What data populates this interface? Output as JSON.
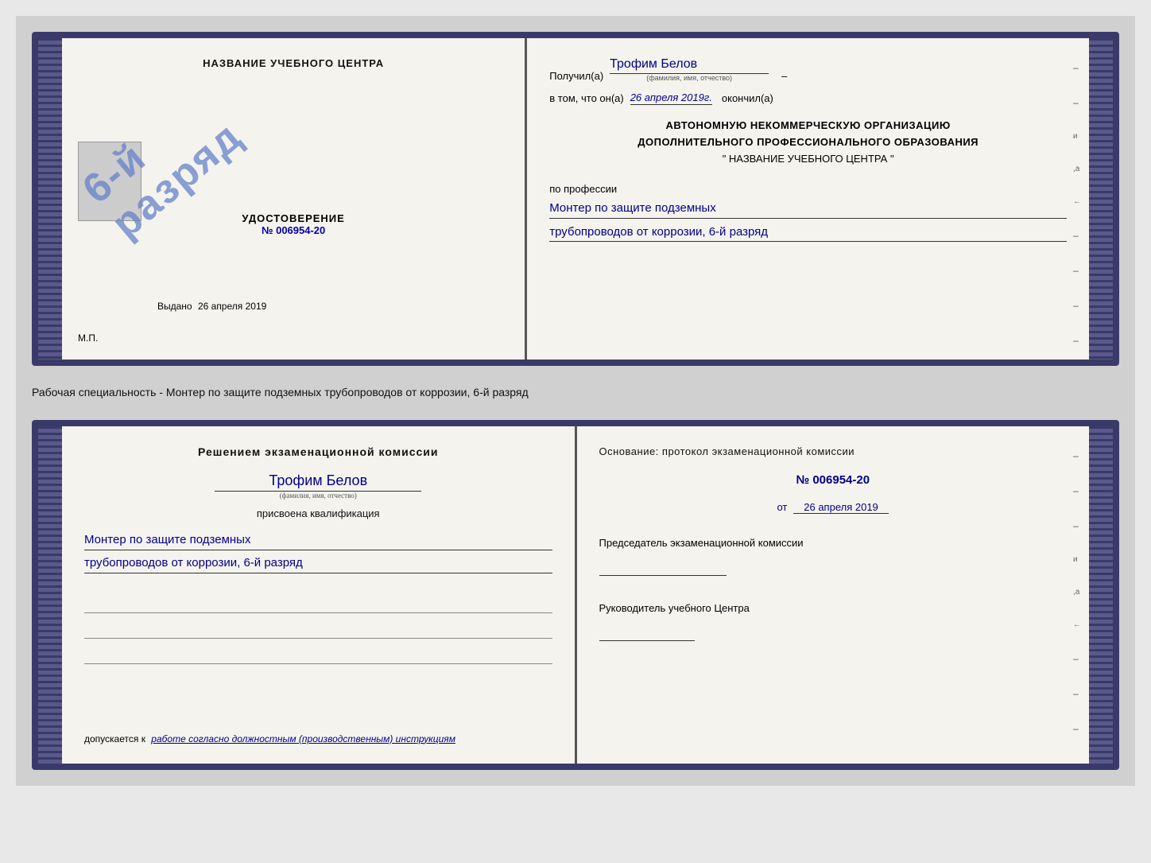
{
  "page": {
    "background": "#d0d0d0"
  },
  "top_book": {
    "left_page": {
      "title": "НАЗВАНИЕ УЧЕБНОГО ЦЕНТРА",
      "udostoverenie_label": "УДОСТОВЕРЕНИЕ",
      "number": "№ 006954-20",
      "vydano_label": "Выдано",
      "vydano_date": "26 апреля 2019",
      "mp_label": "М.П.",
      "stamp_line1": "6-й",
      "stamp_line2": "разряд"
    },
    "right_page": {
      "poluchil_label": "Получил(а)",
      "poluchil_name": "Трофим Белов",
      "name_hint": "(фамилия, имя, отчество)",
      "dash": "–",
      "v_tom_label": "в том, что он(а)",
      "okончил_date": "26 апреля 2019г.",
      "okончил_label": "окончил(а)",
      "org_line1": "АВТОНОМНУЮ НЕКОММЕРЧЕСКУЮ ОРГАНИЗАЦИЮ",
      "org_line2": "ДОПОЛНИТЕЛЬНОГО ПРОФЕССИОНАЛЬНОГО ОБРАЗОВАНИЯ",
      "org_line3": "\"  НАЗВАНИЕ УЧЕБНОГО ЦЕНТРА  \"",
      "po_professii": "по профессии",
      "profession_line1": "Монтер по защите подземных",
      "profession_line2": "трубопроводов от коррозии, 6-й разряд"
    }
  },
  "specialty_text": "Рабочая специальность - Монтер по защите подземных трубопроводов от коррозии, 6-й разряд",
  "bottom_book": {
    "left_page": {
      "resheniem_title": "Решением экзаменационной комиссии",
      "name": "Трофим Белов",
      "name_hint": "(фамилия, имя, отчество)",
      "prisvoena_label": "присвоена квалификация",
      "qualification_line1": "Монтер по защите подземных",
      "qualification_line2": "трубопроводов от коррозии, 6-й разряд",
      "dopuskaetsya_label": "допускается к",
      "dopuskaetsya_text": "работе согласно должностным (производственным) инструкциям"
    },
    "right_page": {
      "osnovanie_label": "Основание: протокол экзаменационной комиссии",
      "number": "№ 006954-20",
      "date_prefix": "от",
      "date": "26 апреля 2019",
      "predsedatel_label": "Председатель экзаменационной комиссии",
      "rukovoditel_label": "Руководитель учебного Центра"
    }
  }
}
